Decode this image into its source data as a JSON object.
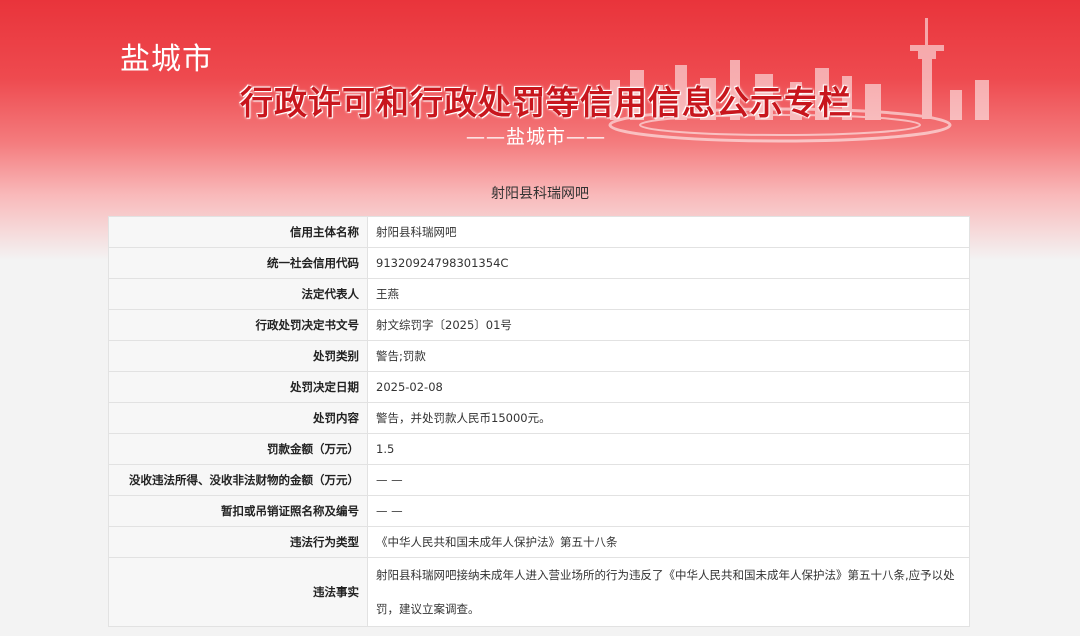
{
  "banner": {
    "city": "盐城市",
    "title": "行政许可和行政处罚等信用信息公示专栏",
    "subtitle": "——盐城市——"
  },
  "entity_name": "射阳县科瑞网吧",
  "rows": [
    {
      "label": "信用主体名称",
      "value": "射阳县科瑞网吧"
    },
    {
      "label": "统一社会信用代码",
      "value": "91320924798301354C"
    },
    {
      "label": "法定代表人",
      "value": "王燕"
    },
    {
      "label": "行政处罚决定书文号",
      "value": "射文综罚字〔2025〕01号"
    },
    {
      "label": "处罚类别",
      "value": "警告;罚款"
    },
    {
      "label": "处罚决定日期",
      "value": "2025-02-08"
    },
    {
      "label": "处罚内容",
      "value": "警告，并处罚款人民币15000元。"
    },
    {
      "label": "罚款金额（万元）",
      "value": "1.5"
    },
    {
      "label": "没收违法所得、没收非法财物的金额（万元）",
      "value": "— —"
    },
    {
      "label": "暂扣或吊销证照名称及编号",
      "value": "— —"
    },
    {
      "label": "违法行为类型",
      "value": "《中华人民共和国未成年人保护法》第五十八条"
    },
    {
      "label": "违法事实",
      "value": "射阳县科瑞网吧接纳未成年人进入营业场所的行为违反了《中华人民共和国未成年人保护法》第五十八条,应予以处罚，建议立案调查。"
    }
  ]
}
